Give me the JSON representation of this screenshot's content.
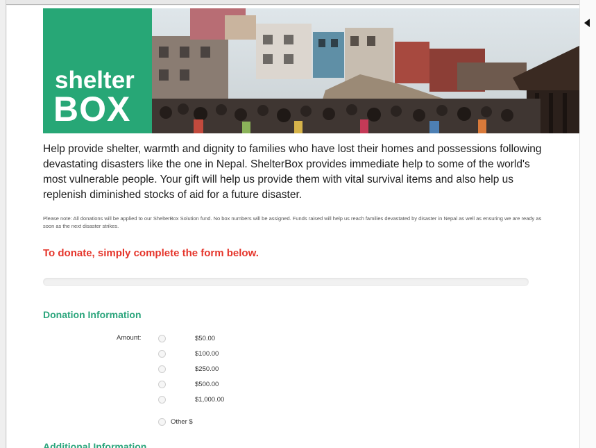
{
  "brand": {
    "logo_line1": "shelter",
    "logo_line2": "BOX",
    "color": "#27a776"
  },
  "intro": "Help provide shelter, warmth and dignity to families who have lost their homes and possessions following devastating disasters like the one in Nepal. ShelterBox provides immediate help to some of the world's most vulnerable people. Your gift will help us provide them with vital survival items and also help us replenish diminished stocks of aid for a future disaster.",
  "note": "Please note: All donations will be applied to our ShelterBox Solution fund. No box numbers will be assigned. Funds raised will help us reach families devastated by disaster in Nepal as well as ensuring we are ready as soon as the next disaster strikes.",
  "cta": "To donate, simply complete the form below.",
  "cta_color": "#e5352b",
  "donation": {
    "title": "Donation Information",
    "amount_label": "Amount:",
    "options": [
      "$50.00",
      "$100.00",
      "$250.00",
      "$500.00",
      "$1,000.00"
    ],
    "other_label": "Other $"
  },
  "additional": {
    "title": "Additional Information"
  },
  "accent_color": "#2ba57c"
}
